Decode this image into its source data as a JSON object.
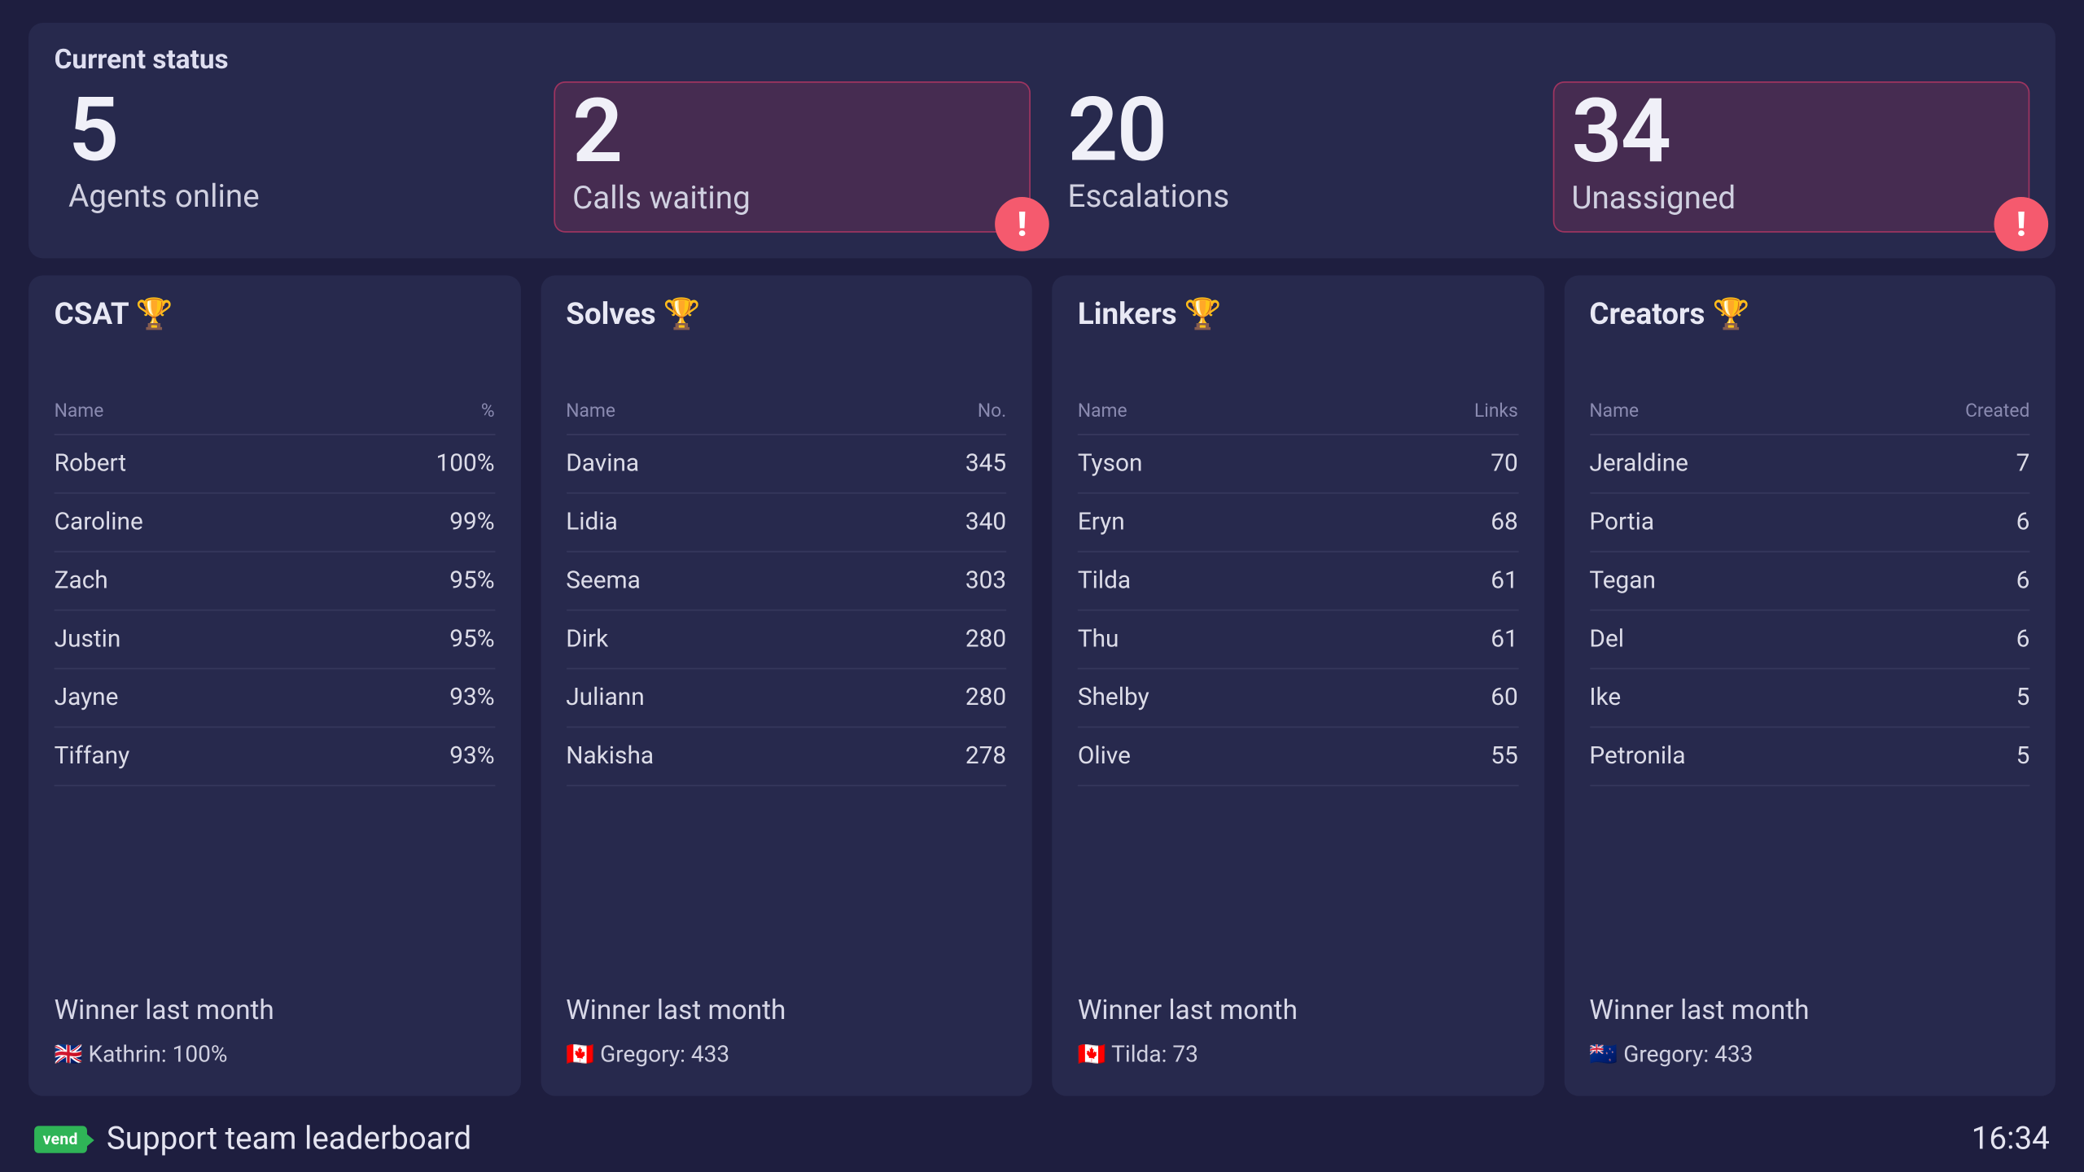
{
  "status": {
    "title": "Current status",
    "items": [
      {
        "value": "5",
        "label": "Agents online",
        "alert": false
      },
      {
        "value": "2",
        "label": "Calls waiting",
        "alert": true
      },
      {
        "value": "20",
        "label": "Escalations",
        "alert": false
      },
      {
        "value": "34",
        "label": "Unassigned",
        "alert": true
      }
    ]
  },
  "boards": [
    {
      "title": "CSAT 🏆",
      "col_name": "Name",
      "col_value": "%",
      "rows": [
        {
          "name": "Robert",
          "value": "100%"
        },
        {
          "name": "Caroline",
          "value": "99%"
        },
        {
          "name": "Zach",
          "value": "95%"
        },
        {
          "name": "Justin",
          "value": "95%"
        },
        {
          "name": "Jayne",
          "value": "93%"
        },
        {
          "name": "Tiffany",
          "value": "93%"
        }
      ],
      "winner_label": "Winner last month",
      "winner": "🇬🇧 Kathrin: 100%"
    },
    {
      "title": "Solves 🏆",
      "col_name": "Name",
      "col_value": "No.",
      "rows": [
        {
          "name": "Davina",
          "value": "345"
        },
        {
          "name": "Lidia",
          "value": "340"
        },
        {
          "name": "Seema",
          "value": "303"
        },
        {
          "name": "Dirk",
          "value": "280"
        },
        {
          "name": "Juliann",
          "value": "280"
        },
        {
          "name": "Nakisha",
          "value": "278"
        }
      ],
      "winner_label": "Winner last month",
      "winner": "🇨🇦 Gregory: 433"
    },
    {
      "title": "Linkers 🏆",
      "col_name": "Name",
      "col_value": "Links",
      "rows": [
        {
          "name": "Tyson",
          "value": "70"
        },
        {
          "name": "Eryn",
          "value": "68"
        },
        {
          "name": "Tilda",
          "value": "61"
        },
        {
          "name": "Thu",
          "value": "61"
        },
        {
          "name": "Shelby",
          "value": "60"
        },
        {
          "name": "Olive",
          "value": "55"
        }
      ],
      "winner_label": "Winner last month",
      "winner": "🇨🇦 Tilda: 73"
    },
    {
      "title": "Creators 🏆",
      "col_name": "Name",
      "col_value": "Created",
      "rows": [
        {
          "name": "Jeraldine",
          "value": "7"
        },
        {
          "name": "Portia",
          "value": "6"
        },
        {
          "name": "Tegan",
          "value": "6"
        },
        {
          "name": "Del",
          "value": "6"
        },
        {
          "name": "Ike",
          "value": "5"
        },
        {
          "name": "Petronila",
          "value": "5"
        }
      ],
      "winner_label": "Winner last month",
      "winner": "🇳🇿 Gregory: 433"
    }
  ],
  "footer": {
    "brand": "vend",
    "page_title": "Support team leaderboard",
    "clock": "16:34"
  }
}
